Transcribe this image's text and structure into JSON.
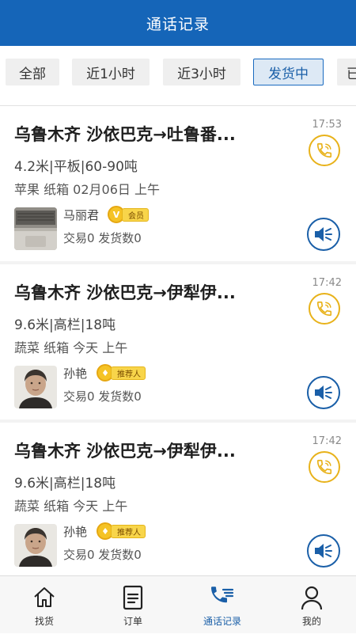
{
  "header": {
    "title": "通话记录"
  },
  "filters": [
    {
      "label": "全部",
      "active": false
    },
    {
      "label": "近1小时",
      "active": false
    },
    {
      "label": "近3小时",
      "active": false
    },
    {
      "label": "发货中",
      "active": true
    },
    {
      "label": "已",
      "active": false
    }
  ],
  "records": [
    {
      "route": "乌鲁木齐 沙依巴克→吐鲁番...",
      "time": "17:53",
      "specs": "4.2米|平板|60-90吨",
      "cargo": "苹果 纸箱 02月06日 上午",
      "name": "马丽君",
      "badge": {
        "icon": "V",
        "text": "会员"
      },
      "stats": "交易0 发货数0"
    },
    {
      "route": "乌鲁木齐 沙依巴克→伊犁伊...",
      "time": "17:42",
      "specs": "9.6米|高栏|18吨",
      "cargo": "蔬菜 纸箱 今天 上午",
      "name": "孙艳",
      "badge": {
        "icon": "♦",
        "text": "推荐人"
      },
      "stats": "交易0 发货数0"
    },
    {
      "route": "乌鲁木齐 沙依巴克→伊犁伊...",
      "time": "17:42",
      "specs": "9.6米|高栏|18吨",
      "cargo": "蔬菜 纸箱 今天 上午",
      "name": "孙艳",
      "badge": {
        "icon": "♦",
        "text": "推荐人"
      },
      "stats": "交易0 发货数0"
    }
  ],
  "tabbar": [
    {
      "label": "找货",
      "icon": "home-icon",
      "active": false
    },
    {
      "label": "订单",
      "icon": "document-icon",
      "active": false
    },
    {
      "label": "通话记录",
      "icon": "call-log-icon",
      "active": true
    },
    {
      "label": "我的",
      "icon": "person-icon",
      "active": false
    }
  ],
  "colors": {
    "primary": "#1565b8",
    "accent_gold": "#e8b21a",
    "active_chip_bg": "#dde9f5"
  }
}
